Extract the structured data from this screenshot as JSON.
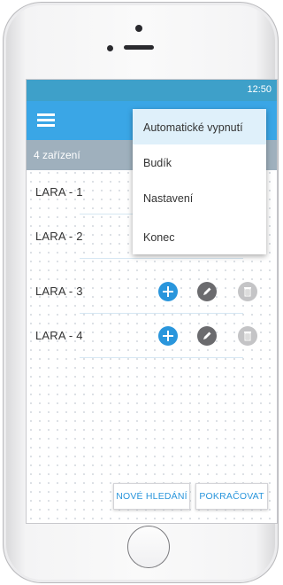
{
  "status_bar": {
    "time": "12:50"
  },
  "app_bar": {
    "menu_icon": "hamburger-icon"
  },
  "subheader": {
    "device_count": "4 zařízení"
  },
  "devices": [
    {
      "name": "LARA - 1"
    },
    {
      "name": "LARA - 2"
    },
    {
      "name": "LARA - 3"
    },
    {
      "name": "LARA - 4"
    }
  ],
  "row_icons": {
    "add": "plus-circle-icon",
    "edit": "pencil-icon",
    "delete": "trash-icon"
  },
  "menu": {
    "items": [
      {
        "label": "Automatické vypnutí",
        "highlighted": true
      },
      {
        "label": "Budík"
      },
      {
        "label": "Nastavení"
      },
      {
        "label": "Konec"
      }
    ]
  },
  "footer": {
    "new_search_label": "NOVÉ HLEDÁNÍ",
    "continue_label": "POKRAČOVAT"
  },
  "colors": {
    "accent": "#2a96dc",
    "app_bar": "#3aa6e6",
    "status_bar": "#3ea0c9",
    "subheader": "#9fb0bd"
  }
}
